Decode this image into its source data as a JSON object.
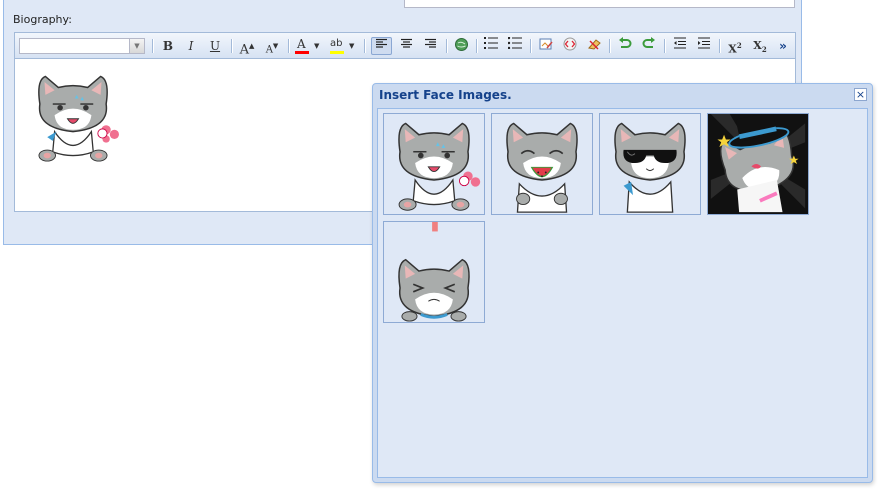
{
  "form": {
    "biography_label": "Biography:"
  },
  "editor": {
    "font_family_value": "",
    "toolbar": {
      "bold": "B",
      "italic": "I",
      "underline": "U",
      "grow_font": "A",
      "shrink_font": "A",
      "font_color": "A",
      "highlight": "ab",
      "superscript": "X",
      "subscript": "X",
      "more": "»"
    }
  },
  "face_window": {
    "title": "Insert Face Images.",
    "close_symbol": "×",
    "faces": [
      {
        "name": "sweaty cat sticking tongue out"
      },
      {
        "name": "cat eating watermelon"
      },
      {
        "name": "cat wearing sunglasses"
      },
      {
        "name": "cat in top hat on starry background"
      },
      {
        "name": "cat squinting"
      }
    ]
  },
  "colors": {
    "panel_bg": "#dfe8f6",
    "border": "#99bbe8",
    "title_text": "#15428b",
    "cat_gray": "#a9acab",
    "font_color_bar": "#ff0000",
    "highlight_bar": "#ffff00"
  }
}
